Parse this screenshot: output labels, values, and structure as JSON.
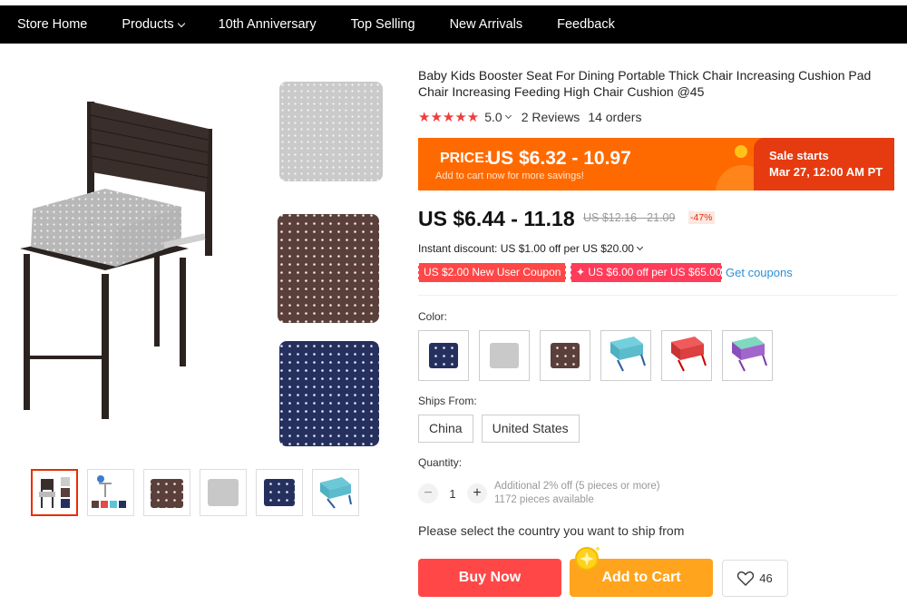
{
  "nav": {
    "items": [
      {
        "label": "Store Home",
        "has_chevron": false
      },
      {
        "label": "Products",
        "has_chevron": true
      },
      {
        "label": "10th Anniversary",
        "has_chevron": false
      },
      {
        "label": "Top Selling",
        "has_chevron": false
      },
      {
        "label": "New Arrivals",
        "has_chevron": false
      },
      {
        "label": "Feedback",
        "has_chevron": false
      }
    ]
  },
  "product": {
    "title": "Baby Kids Booster Seat For Dining Portable Thick Chair Increasing Cushion Pad Chair Increasing Feeding High Chair Cushion @45",
    "stars": "★★★★★",
    "rating": "5.0",
    "reviews": "2 Reviews",
    "orders": "14 orders"
  },
  "promo": {
    "price_label": "PRICE:",
    "price_range": "US $6.32 - 10.97",
    "subtext": "Add to cart now for more savings!",
    "sale_title": "Sale starts",
    "sale_date": "Mar 27, 12:00 AM PT"
  },
  "pricing": {
    "current": "US $6.44 - 11.18",
    "original": "US $12.16 - 21.09",
    "discount": "-47%",
    "instant_discount": "Instant discount: US $1.00 off per US $20.00"
  },
  "coupons": {
    "new_user": "US $2.00 New User Coupon",
    "store": "✦ US $6.00 off per US $65.00",
    "get_link": "Get coupons"
  },
  "variants": {
    "color_label": "Color:",
    "colors": [
      "navy-polka-dot",
      "grey-polka-dot",
      "brown-polka-dot",
      "turquoise",
      "red",
      "mint-purple"
    ],
    "ships_label": "Ships From:",
    "ships_from": [
      "China",
      "United States"
    ]
  },
  "quantity": {
    "label": "Quantity:",
    "minus": "−",
    "value": "1",
    "plus": "+",
    "note1": "Additional 2% off (5 pieces or more)",
    "note2": "1172 pieces available"
  },
  "shipping_note": "Please select the country you want to ship from",
  "actions": {
    "buy_now": "Buy Now",
    "add_to_cart": "Add to Cart",
    "wishlist_count": "46"
  },
  "colors": {
    "nav_bg": "#000000",
    "promo_orange": "#ff6a00",
    "sale_red": "#e63b10",
    "buy_red": "#ff4747",
    "cart_orange": "#ffa41c",
    "star_red": "#f03d3d",
    "link_blue": "#2d8fd6"
  }
}
